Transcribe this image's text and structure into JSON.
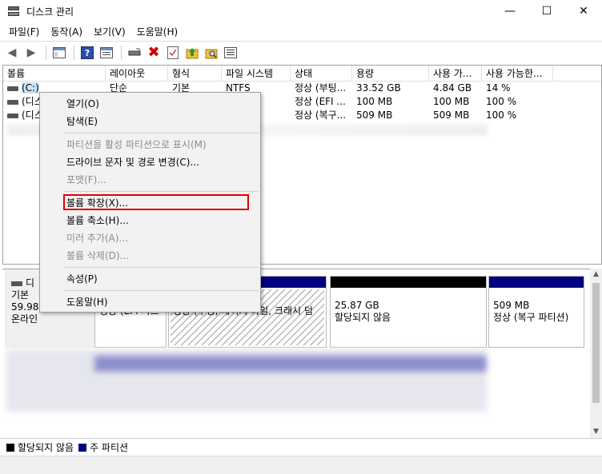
{
  "window": {
    "title": "디스크 관리"
  },
  "menubar": [
    "파일(F)",
    "동작(A)",
    "보기(V)",
    "도움말(H)"
  ],
  "columns": [
    "볼륨",
    "레이아웃",
    "형식",
    "파일 시스템",
    "상태",
    "용량",
    "사용 가...",
    "사용 가능한..."
  ],
  "volumes": [
    {
      "name": "(C:)",
      "layout": "단순",
      "type": "기본",
      "fs": "NTFS",
      "status": "정상 (부팅...",
      "capacity": "33.52 GB",
      "free": "4.84 GB",
      "free_pct": "14 %"
    },
    {
      "name": "(디스...",
      "layout": "",
      "type": "",
      "fs": "",
      "status": "정상 (EFI ...",
      "capacity": "100 MB",
      "free": "100 MB",
      "free_pct": "100 %"
    },
    {
      "name": "(디스...",
      "layout": "",
      "type": "",
      "fs": "",
      "status": "정상 (복구...",
      "capacity": "509 MB",
      "free": "509 MB",
      "free_pct": "100 %"
    }
  ],
  "disk": {
    "name": "디",
    "kind": "기본",
    "size": "59.98 (",
    "state": "온라인"
  },
  "partitions": [
    {
      "status": "정상 (EFI 시스"
    },
    {
      "status": "정상 (부팅, 페이지 파일, 크래시 덤"
    },
    {
      "size": "25.87 GB",
      "status": "할당되지 않음"
    },
    {
      "size": "509 MB",
      "status": "정상 (복구 파티션)"
    }
  ],
  "legend": {
    "unallocated": "할당되지 않음",
    "primary": "주 파티션"
  },
  "context_menu": {
    "open": "열기(O)",
    "explore": "탐색(E)",
    "mark_active": "파티션을 활성 파티션으로 표시(M)",
    "change_letter": "드라이브 문자 및 경로 변경(C)...",
    "format": "포맷(F)...",
    "extend": "볼륨 확장(X)...",
    "shrink": "볼륨 축소(H)...",
    "add_mirror": "미러 추가(A)...",
    "delete": "볼륨 삭제(D)...",
    "properties": "속성(P)",
    "help": "도움말(H)"
  },
  "colors": {
    "primary_partition": "#000080",
    "unallocated": "#000000",
    "highlight": "#e00000"
  }
}
